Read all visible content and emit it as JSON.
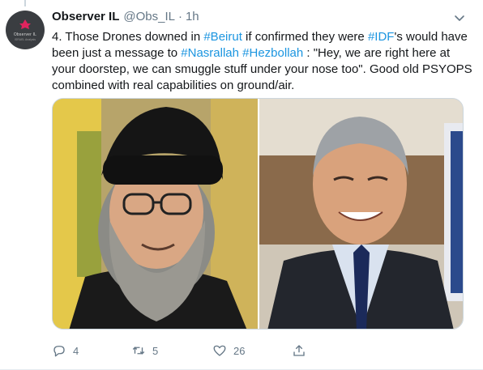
{
  "author": {
    "display_name": "Observer IL",
    "handle": "@Obs_IL",
    "separator": "·",
    "time": "1h",
    "avatar_logo": "Observer IL",
    "avatar_sub": "ISRAEL Analysis",
    "avatar_bg": "#3a3d41",
    "avatar_mark_color": "#e0245e"
  },
  "tweet": {
    "text_segments": [
      {
        "text": "4. Those Drones downed in ",
        "link": false
      },
      {
        "text": "#Beirut",
        "link": true
      },
      {
        "text": " if confirmed they were ",
        "link": false
      },
      {
        "text": "#IDF",
        "link": true
      },
      {
        "text": "'s would have been just a message to ",
        "link": false
      },
      {
        "text": "#Nasrallah",
        "link": true
      },
      {
        "text": " ",
        "link": false
      },
      {
        "text": "#Hezbollah",
        "link": true
      },
      {
        "text": " : \"Hey, we are right here at your doorstep, we can smuggle stuff under your nose too\". Good old PSYOPS combined with real capabilities on ground/air.",
        "link": false
      }
    ],
    "link_color": "#1b95e0"
  },
  "media": {
    "photos": [
      {
        "name": "photo-left",
        "subject": "man-black-turban-glasses-grey-beard"
      },
      {
        "name": "photo-right",
        "subject": "smiling-man-suit-blue-tie"
      }
    ]
  },
  "actions": {
    "reply_count": "4",
    "retweet_count": "5",
    "like_count": "26",
    "icons": [
      "reply-icon",
      "retweet-icon",
      "like-icon",
      "share-icon"
    ],
    "icon_color": "#657786"
  }
}
